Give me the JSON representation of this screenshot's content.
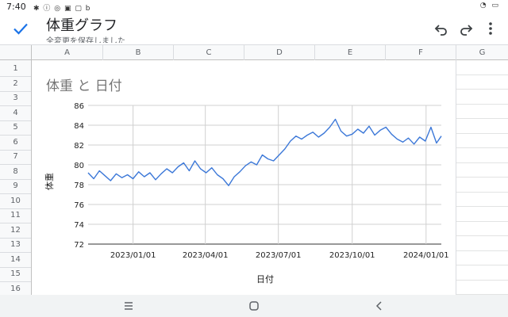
{
  "status_bar": {
    "time": "7:40",
    "left_icons": "✱ ⓘ ◎ ▣ ▢ b",
    "right_icons": "◔ ▭"
  },
  "header": {
    "title": "体重グラフ",
    "save_status": "全変更を保存しました"
  },
  "columns": [
    "A",
    "B",
    "C",
    "D",
    "E",
    "F",
    "G"
  ],
  "rows": [
    "1",
    "2",
    "3",
    "4",
    "5",
    "6",
    "7",
    "8",
    "9",
    "10",
    "11",
    "12",
    "13",
    "14",
    "15",
    "16"
  ],
  "colors": {
    "line": "#3c78d8",
    "accent": "#1a73e8"
  },
  "icons": {
    "check": "check-icon",
    "undo": "undo-icon",
    "redo": "redo-icon",
    "more": "more-vert-icon"
  },
  "chart_data": {
    "type": "line",
    "title": "体重 と 日付",
    "xlabel": "日付",
    "ylabel": "体重",
    "ylim": [
      72,
      86
    ],
    "yticks": [
      "72",
      "74",
      "76",
      "78",
      "80",
      "82",
      "84",
      "86"
    ],
    "xticks": [
      "2023/01/01",
      "2023/04/01",
      "2023/07/01",
      "2023/10/01",
      "2024/01/01"
    ],
    "xlim": [
      "2022-11-06",
      "2024-01-20"
    ],
    "grid": true,
    "legend": "none",
    "series": [
      {
        "points": [
          [
            "2022-11-06",
            79.2
          ],
          [
            "2022-11-13",
            78.6
          ],
          [
            "2022-11-20",
            79.4
          ],
          [
            "2022-11-27",
            78.9
          ],
          [
            "2022-12-04",
            78.4
          ],
          [
            "2022-12-11",
            79.1
          ],
          [
            "2022-12-18",
            78.7
          ],
          [
            "2022-12-25",
            79.0
          ],
          [
            "2023-01-01",
            78.6
          ],
          [
            "2023-01-08",
            79.3
          ],
          [
            "2023-01-15",
            78.8
          ],
          [
            "2023-01-22",
            79.2
          ],
          [
            "2023-01-29",
            78.5
          ],
          [
            "2023-02-05",
            79.1
          ],
          [
            "2023-02-12",
            79.6
          ],
          [
            "2023-02-19",
            79.2
          ],
          [
            "2023-02-26",
            79.8
          ],
          [
            "2023-03-05",
            80.2
          ],
          [
            "2023-03-12",
            79.4
          ],
          [
            "2023-03-19",
            80.4
          ],
          [
            "2023-03-26",
            79.6
          ],
          [
            "2023-04-02",
            79.2
          ],
          [
            "2023-04-09",
            79.7
          ],
          [
            "2023-04-16",
            79.0
          ],
          [
            "2023-04-23",
            78.6
          ],
          [
            "2023-04-30",
            77.9
          ],
          [
            "2023-05-07",
            78.8
          ],
          [
            "2023-05-14",
            79.3
          ],
          [
            "2023-05-21",
            79.9
          ],
          [
            "2023-05-28",
            80.3
          ],
          [
            "2023-06-04",
            80.0
          ],
          [
            "2023-06-11",
            81.0
          ],
          [
            "2023-06-18",
            80.6
          ],
          [
            "2023-06-25",
            80.4
          ],
          [
            "2023-07-02",
            81.0
          ],
          [
            "2023-07-09",
            81.6
          ],
          [
            "2023-07-16",
            82.4
          ],
          [
            "2023-07-23",
            82.9
          ],
          [
            "2023-07-30",
            82.6
          ],
          [
            "2023-08-06",
            83.0
          ],
          [
            "2023-08-13",
            83.3
          ],
          [
            "2023-08-20",
            82.8
          ],
          [
            "2023-08-27",
            83.2
          ],
          [
            "2023-09-03",
            83.8
          ],
          [
            "2023-09-10",
            84.6
          ],
          [
            "2023-09-17",
            83.4
          ],
          [
            "2023-09-24",
            82.9
          ],
          [
            "2023-10-01",
            83.1
          ],
          [
            "2023-10-08",
            83.6
          ],
          [
            "2023-10-15",
            83.2
          ],
          [
            "2023-10-22",
            83.9
          ],
          [
            "2023-10-29",
            83.0
          ],
          [
            "2023-11-05",
            83.5
          ],
          [
            "2023-11-12",
            83.8
          ],
          [
            "2023-11-19",
            83.1
          ],
          [
            "2023-11-26",
            82.6
          ],
          [
            "2023-12-03",
            82.3
          ],
          [
            "2023-12-10",
            82.7
          ],
          [
            "2023-12-17",
            82.1
          ],
          [
            "2023-12-24",
            82.8
          ],
          [
            "2023-12-31",
            82.4
          ],
          [
            "2024-01-07",
            83.8
          ],
          [
            "2024-01-14",
            82.2
          ],
          [
            "2024-01-20",
            82.9
          ]
        ]
      }
    ]
  }
}
